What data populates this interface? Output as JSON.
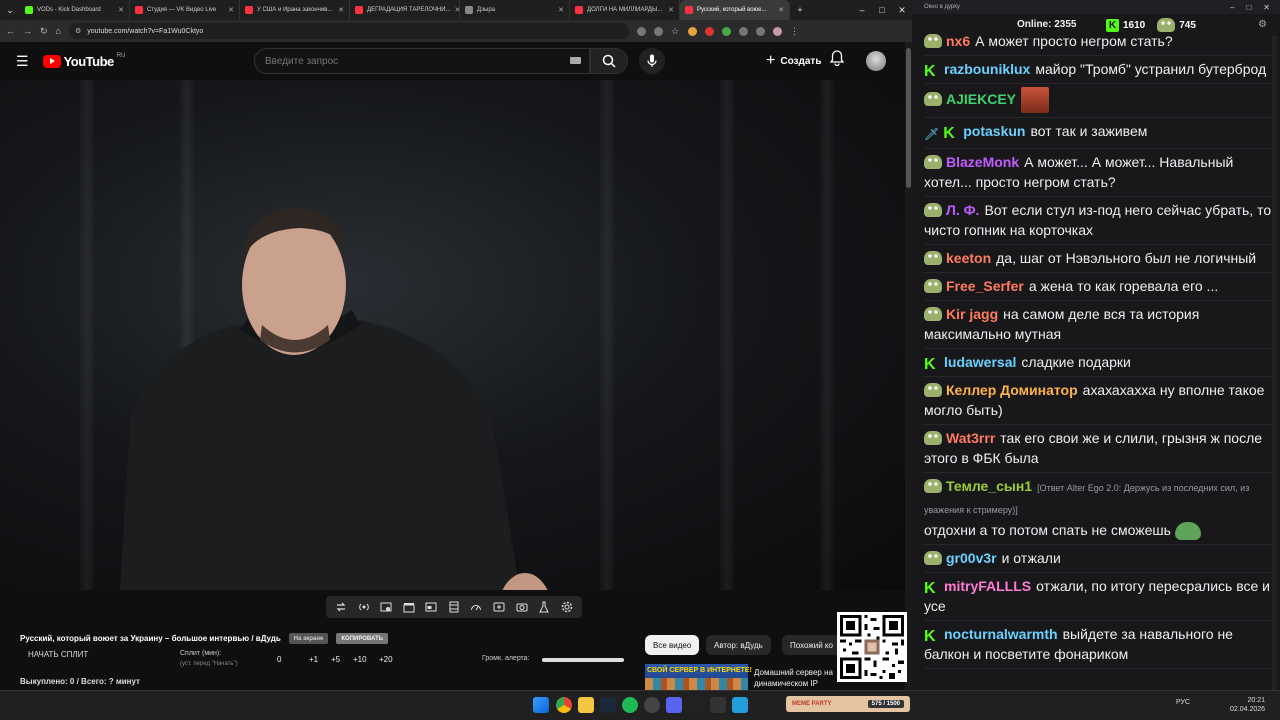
{
  "tabs": [
    {
      "label": "VODs - Kick Dashboard",
      "color": "#53fc18"
    },
    {
      "label": "Студия — VK Видео Live",
      "color": "#ff3040"
    },
    {
      "label": "У США и Ирана закончив...",
      "color": "#ff3040"
    },
    {
      "label": "ДЕГРАДАЦИЯ ТАРЕЛОЧНИ...",
      "color": "#ff3040"
    },
    {
      "label": "Дзыра",
      "color": "#888888"
    },
    {
      "label": "ДОЛГИ НА МИЛЛИАРДЫ...",
      "color": "#ff3040"
    },
    {
      "label": "Русский, который воюе...",
      "color": "#ff3040",
      "active": true
    }
  ],
  "address": {
    "url": "youtube.com/watch?v=Fa1Wu0Cktyo"
  },
  "youtube": {
    "logo_text": "YouTube",
    "region": "RU",
    "search_placeholder": "Введите запрос",
    "create_label": "Создать",
    "create_plus": "+"
  },
  "video": {
    "title": "Русский, который воюет за Украину – большое интервью / вДудь",
    "on_screen_label": "На экране",
    "copy_label": "КОПИРОВАТЬ"
  },
  "split": {
    "start_label": "НАЧАТЬ СПЛИТ",
    "label": "Сплит (мин):",
    "sublabel": "(уст. перед \"Начать\")",
    "values": [
      "0",
      "+1",
      "+5",
      "+10",
      "+20"
    ]
  },
  "alert": {
    "label": "Громк. алерта:",
    "volume": 1.0
  },
  "bought": "Выкуплено: 0 / Всего: ? минут",
  "chips": [
    "Все видео",
    "Автор: вДудь",
    "Похожий ко"
  ],
  "ad": {
    "banner": "СВОЙ СЕРВЕР В ИНТЕРНЕТЕ!",
    "title": "Домашний сервер на динамическом IP бесплатно!"
  },
  "chat": {
    "window_title": "Окно в дурку",
    "online_label": "Online:",
    "online_count": "2355",
    "kick_count": "1610",
    "pepe_count": "745",
    "messages": [
      {
        "user": "nx6",
        "color": "#ff7b5c",
        "text": "А может просто негром стать?",
        "badge": "pepe"
      },
      {
        "user": "razbouniklux",
        "color": "#6ad1ff",
        "text": "майор \"Тромб\" устранил бутерброд",
        "badge": "kick"
      },
      {
        "user": "AJIEKCEY",
        "color": "#3fd26e",
        "text": "",
        "badge": "pepe",
        "emote": true
      },
      {
        "user": "potaskun",
        "color": "#6ad1ff",
        "text": "вот так и заживем",
        "badge": "kick",
        "sword": true
      },
      {
        "user": "BlazeMonk",
        "color": "#c05cff",
        "text": "А может... А может... Навальный хотел... просто негром стать?",
        "badge": "pepe"
      },
      {
        "user": "Л. Ф.",
        "color": "#c05cff",
        "text": "Вот если стул из-под него сейчас убрать, то чисто гопник на корточках",
        "badge": "pepe"
      },
      {
        "user": "keeton",
        "color": "#ff7b5c",
        "text": "да, шаг от Нэвэльного был не логичный",
        "badge": "pepe"
      },
      {
        "user": "Free_Serfer",
        "color": "#ff7b5c",
        "text": "а жена то как горевала его ...",
        "badge": "pepe"
      },
      {
        "user": "Kir jagg",
        "color": "#ff7b5c",
        "text": "на самом деле вся та история максимально мутная",
        "badge": "pepe"
      },
      {
        "user": "ludawersal",
        "color": "#6ad1ff",
        "text": "сладкие подарки",
        "badge": "kick"
      },
      {
        "user": "Келлер Доминатор",
        "color": "#ffb347",
        "text": "ахахахахха ну вполне такое могло быть)",
        "badge": "pepe"
      },
      {
        "user": "Wat3rrr",
        "color": "#ff7b5c",
        "text": "так его свои же и слили, грызня ж после этого в ФБК была",
        "badge": "pepe"
      },
      {
        "user": "Темле_сын1",
        "color": "#9acd32",
        "reply": "[Ответ Alter Ego 2.0: Держусь из последних сил, из уважения к стримеру)]",
        "text": "отдохни а то потом спать не сможешь",
        "badge": "pepe",
        "frog": true
      },
      {
        "user": "gr00v3r",
        "color": "#6ad1ff",
        "text": "и отжали",
        "badge": "pepe"
      },
      {
        "user": "mitryFALLLS",
        "color": "#ff7bd5",
        "text": "отжали, по итогу пересрались все и усе",
        "badge": "kick"
      },
      {
        "user": "nocturnalwarmth",
        "color": "#6ad1ff",
        "text": "выйдете за навального не балкон и посветите фонариком",
        "badge": "kick"
      }
    ]
  },
  "taskbar": {
    "meme": "MEME PARTY",
    "meme_count": "575 / 1500",
    "lang": "РУС",
    "time": "20:21",
    "date": "02.04.2026"
  }
}
